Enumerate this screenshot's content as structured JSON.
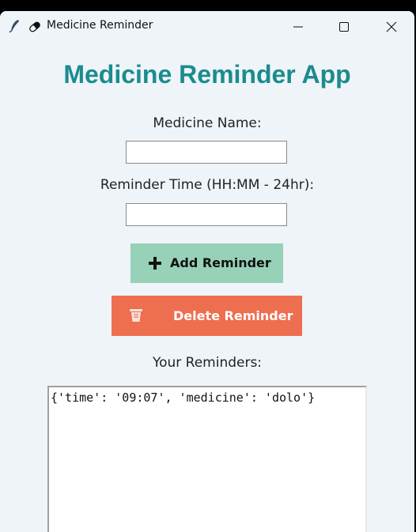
{
  "window": {
    "title": "Medicine Reminder",
    "icons": [
      "feather-icon",
      "pill-icon"
    ],
    "controls": [
      "minimize",
      "maximize",
      "close"
    ]
  },
  "main": {
    "heading": "Medicine Reminder App",
    "medicine_name_label": "Medicine Name:",
    "medicine_name_value": "",
    "reminder_time_label": "Reminder Time (HH:MM - 24hr):",
    "reminder_time_value": "",
    "add_button_label": "Add Reminder",
    "delete_button_label": "Delete Reminder",
    "reminders_label": "Your Reminders:",
    "reminders": [
      "{'time': '09:07', 'medicine': 'dolo'}"
    ]
  },
  "colors": {
    "heading": "#1b8c8e",
    "add_button_bg": "#96d1b8",
    "delete_button_bg": "#ee6e50",
    "window_bg": "#eff4f8"
  }
}
